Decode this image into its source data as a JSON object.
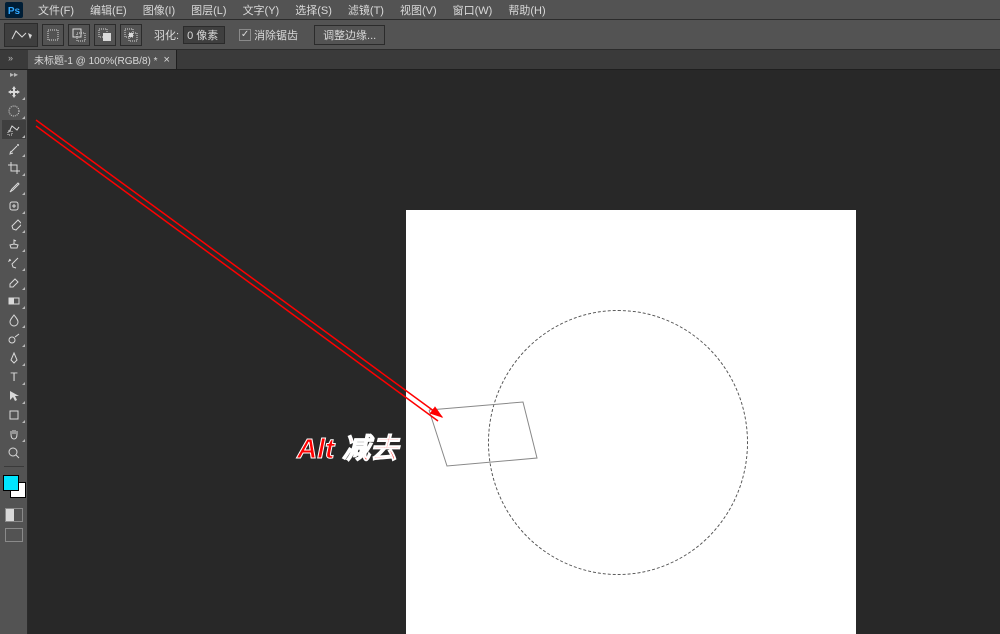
{
  "menubar": {
    "items": [
      "文件(F)",
      "编辑(E)",
      "图像(I)",
      "图层(L)",
      "文字(Y)",
      "选择(S)",
      "滤镜(T)",
      "视图(V)",
      "窗口(W)",
      "帮助(H)"
    ]
  },
  "options": {
    "feather_label": "羽化:",
    "feather_value": "0 像素",
    "antialias_label": "消除锯齿",
    "refine_label": "调整边缘..."
  },
  "document": {
    "tab_title": "未标题-1 @ 100%(RGB/8) *"
  },
  "swatches": {
    "foreground": "#00e5ff"
  },
  "annotation": {
    "text": "Alt 减去"
  }
}
